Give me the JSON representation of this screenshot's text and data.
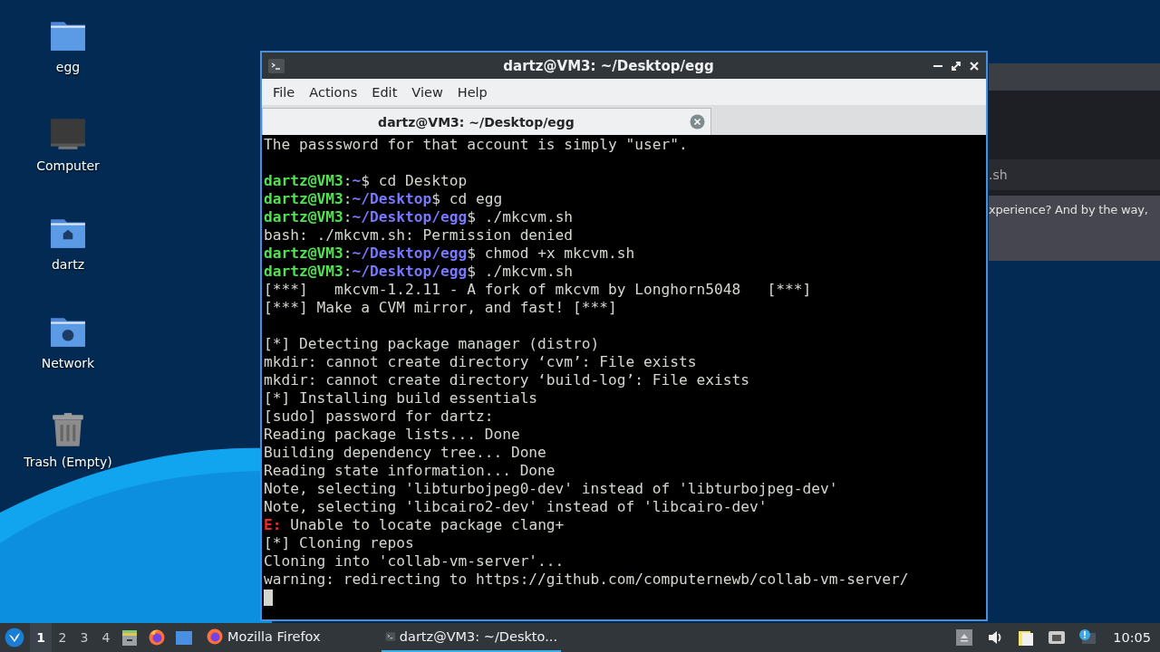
{
  "desktop_icons": [
    {
      "label": "egg",
      "kind": "folder"
    },
    {
      "label": "Computer",
      "kind": "computer"
    },
    {
      "label": "dartz",
      "kind": "home"
    },
    {
      "label": "Network",
      "kind": "network"
    },
    {
      "label": "Trash (Empty)",
      "kind": "trash"
    }
  ],
  "background_window": {
    "file_text": ".sh",
    "message_text": "xperience? And by the way,"
  },
  "terminal": {
    "title": "dartz@VM3: ~/Desktop/egg",
    "menu": [
      "File",
      "Actions",
      "Edit",
      "View",
      "Help"
    ],
    "tabs": [
      {
        "label": "dartz@VM3: ~/Desktop/egg",
        "selected": true
      }
    ],
    "lines": [
      {
        "kind": "text",
        "spans": [
          {
            "kind": "plain",
            "text": "The passsword for that account is simply \"user\"."
          }
        ]
      },
      {
        "kind": "blank"
      },
      {
        "kind": "text",
        "spans": [
          {
            "kind": "user",
            "text": "dartz@VM3"
          },
          {
            "kind": "plain",
            "text": ":"
          },
          {
            "kind": "path",
            "text": "~"
          },
          {
            "kind": "plain",
            "text": "$ cd Desktop"
          }
        ]
      },
      {
        "kind": "text",
        "spans": [
          {
            "kind": "user",
            "text": "dartz@VM3"
          },
          {
            "kind": "plain",
            "text": ":"
          },
          {
            "kind": "path",
            "text": "~/Desktop"
          },
          {
            "kind": "plain",
            "text": "$ cd egg"
          }
        ]
      },
      {
        "kind": "text",
        "spans": [
          {
            "kind": "user",
            "text": "dartz@VM3"
          },
          {
            "kind": "plain",
            "text": ":"
          },
          {
            "kind": "path",
            "text": "~/Desktop/egg"
          },
          {
            "kind": "plain",
            "text": "$ ./mkcvm.sh"
          }
        ]
      },
      {
        "kind": "text",
        "spans": [
          {
            "kind": "plain",
            "text": "bash: ./mkcvm.sh: Permission denied"
          }
        ]
      },
      {
        "kind": "text",
        "spans": [
          {
            "kind": "user",
            "text": "dartz@VM3"
          },
          {
            "kind": "plain",
            "text": ":"
          },
          {
            "kind": "path",
            "text": "~/Desktop/egg"
          },
          {
            "kind": "plain",
            "text": "$ chmod +x mkcvm.sh"
          }
        ]
      },
      {
        "kind": "text",
        "spans": [
          {
            "kind": "user",
            "text": "dartz@VM3"
          },
          {
            "kind": "plain",
            "text": ":"
          },
          {
            "kind": "path",
            "text": "~/Desktop/egg"
          },
          {
            "kind": "plain",
            "text": "$ ./mkcvm.sh"
          }
        ]
      },
      {
        "kind": "text",
        "spans": [
          {
            "kind": "plain",
            "text": "[***]   mkcvm-1.2.11 - A fork of mkcvm by Longhorn5048   [***]"
          }
        ]
      },
      {
        "kind": "text",
        "spans": [
          {
            "kind": "plain",
            "text": "[***] Make a CVM mirror, and fast! [***]"
          }
        ]
      },
      {
        "kind": "blank"
      },
      {
        "kind": "text",
        "spans": [
          {
            "kind": "plain",
            "text": "[*] Detecting package manager (distro)"
          }
        ]
      },
      {
        "kind": "text",
        "spans": [
          {
            "kind": "plain",
            "text": "mkdir: cannot create directory ‘cvm’: File exists"
          }
        ]
      },
      {
        "kind": "text",
        "spans": [
          {
            "kind": "plain",
            "text": "mkdir: cannot create directory ‘build-log’: File exists"
          }
        ]
      },
      {
        "kind": "text",
        "spans": [
          {
            "kind": "plain",
            "text": "[*] Installing build essentials"
          }
        ]
      },
      {
        "kind": "text",
        "spans": [
          {
            "kind": "plain",
            "text": "[sudo] password for dartz:"
          }
        ]
      },
      {
        "kind": "text",
        "spans": [
          {
            "kind": "plain",
            "text": "Reading package lists... Done"
          }
        ]
      },
      {
        "kind": "text",
        "spans": [
          {
            "kind": "plain",
            "text": "Building dependency tree... Done"
          }
        ]
      },
      {
        "kind": "text",
        "spans": [
          {
            "kind": "plain",
            "text": "Reading state information... Done"
          }
        ]
      },
      {
        "kind": "text",
        "spans": [
          {
            "kind": "plain",
            "text": "Note, selecting 'libturbojpeg0-dev' instead of 'libturbojpeg-dev'"
          }
        ]
      },
      {
        "kind": "text",
        "spans": [
          {
            "kind": "plain",
            "text": "Note, selecting 'libcairo2-dev' instead of 'libcairo-dev'"
          }
        ]
      },
      {
        "kind": "text",
        "spans": [
          {
            "kind": "error",
            "text": "E:"
          },
          {
            "kind": "plain",
            "text": " Unable to locate package clang+"
          }
        ]
      },
      {
        "kind": "text",
        "spans": [
          {
            "kind": "plain",
            "text": "[*] Cloning repos"
          }
        ]
      },
      {
        "kind": "text",
        "spans": [
          {
            "kind": "plain",
            "text": "Cloning into 'collab-vm-server'..."
          }
        ]
      },
      {
        "kind": "text",
        "spans": [
          {
            "kind": "plain",
            "text": "warning: redirecting to https://github.com/computernewb/collab-vm-server/"
          }
        ]
      },
      {
        "kind": "cursor"
      }
    ]
  },
  "taskbar": {
    "workspaces": [
      {
        "label": "1",
        "selected": true
      },
      {
        "label": "2",
        "selected": false
      },
      {
        "label": "3",
        "selected": false
      },
      {
        "label": "4",
        "selected": false
      }
    ],
    "tasks": [
      {
        "label": "Mozilla Firefox",
        "kind": "browser",
        "selected": false
      },
      {
        "label": "dartz@VM3: ~/Deskto...",
        "kind": "terminal",
        "selected": true
      }
    ],
    "clock": "10:05"
  }
}
